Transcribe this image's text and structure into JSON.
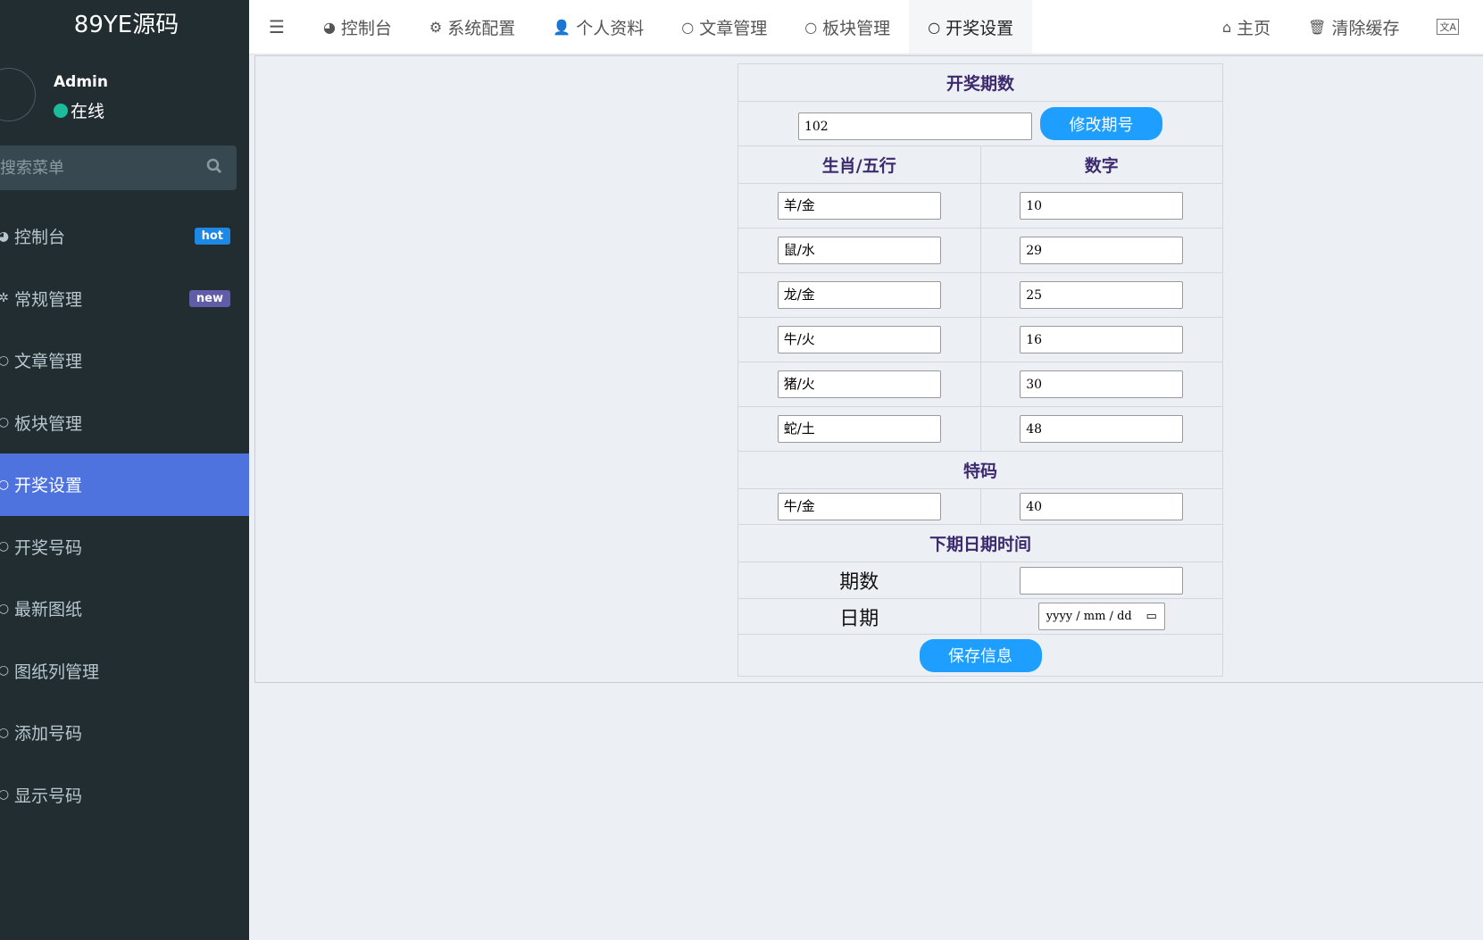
{
  "app": {
    "title": "89YE源码"
  },
  "user": {
    "name": "Admin",
    "status": "在线",
    "status_color": "#1abc9c"
  },
  "search": {
    "placeholder": "搜索菜单"
  },
  "sidebar": {
    "items": [
      {
        "label": "控制台",
        "icon": "dashboard-icon",
        "badge": "hot",
        "badge_color": "#1e88e5"
      },
      {
        "label": "常规管理",
        "icon": "cogs-icon",
        "badge": "new",
        "badge_color": "#605ca8"
      },
      {
        "label": "文章管理",
        "icon": "circle-icon"
      },
      {
        "label": "板块管理",
        "icon": "circle-icon"
      },
      {
        "label": "开奖设置",
        "icon": "circle-icon",
        "active": true
      },
      {
        "label": "开奖号码",
        "icon": "circle-icon"
      },
      {
        "label": "最新图纸",
        "icon": "circle-icon"
      },
      {
        "label": "图纸列管理",
        "icon": "circle-icon"
      },
      {
        "label": "添加号码",
        "icon": "circle-icon"
      },
      {
        "label": "显示号码",
        "icon": "circle-icon"
      }
    ]
  },
  "topbar": {
    "tabs": [
      {
        "label": "控制台",
        "icon": "dashboard-icon"
      },
      {
        "label": "系统配置",
        "icon": "gear-icon"
      },
      {
        "label": "个人资料",
        "icon": "user-icon"
      },
      {
        "label": "文章管理",
        "icon": "circle-icon"
      },
      {
        "label": "板块管理",
        "icon": "circle-icon"
      },
      {
        "label": "开奖设置",
        "icon": "circle-icon",
        "active": true
      }
    ],
    "home": "主页",
    "clear_cache": "清除缓存"
  },
  "form": {
    "period_title": "开奖期数",
    "period_value": "102",
    "modify_button": "修改期号",
    "col_zodiac": "生肖/五行",
    "col_number": "数字",
    "rows": [
      {
        "zodiac": "羊/金",
        "number": "10"
      },
      {
        "zodiac": "鼠/水",
        "number": "29"
      },
      {
        "zodiac": "龙/金",
        "number": "25"
      },
      {
        "zodiac": "牛/火",
        "number": "16"
      },
      {
        "zodiac": "猪/火",
        "number": "30"
      },
      {
        "zodiac": "蛇/土",
        "number": "48"
      }
    ],
    "special_title": "特码",
    "special": {
      "zodiac": "牛/金",
      "number": "40"
    },
    "next_title": "下期日期时间",
    "next_period_label": "期数",
    "next_period_value": "",
    "date_label": "日期",
    "date_placeholder": "yyyy / mm / dd",
    "save_button": "保存信息"
  },
  "colors": {
    "accent": "#1e9fff",
    "sidebar_bg": "#222d32",
    "active_menu": "#4e73df",
    "heading": "#3d2a6e"
  }
}
